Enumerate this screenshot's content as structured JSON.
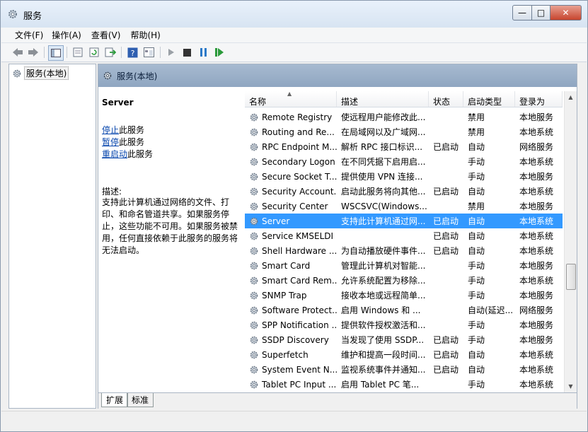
{
  "window": {
    "title": "服务",
    "min_glyph": "—",
    "max_glyph": "□",
    "close_glyph": "✕"
  },
  "menu": [
    "文件(F)",
    "操作(A)",
    "查看(V)",
    "帮助(H)"
  ],
  "tree": {
    "root_label": "服务(本地)"
  },
  "header": {
    "title": "服务(本地)"
  },
  "description": {
    "service_name": "Server",
    "actions": [
      {
        "link": "停止",
        "suffix": "此服务"
      },
      {
        "link": "暂停",
        "suffix": "此服务"
      },
      {
        "link": "重启动",
        "suffix": "此服务"
      }
    ],
    "label": "描述:",
    "text": "支持此计算机通过网络的文件、打印、和命名管道共享。如果服务停止，这些功能不可用。如果服务被禁用，任何直接依赖于此服务的服务将无法启动。"
  },
  "columns": [
    "名称",
    "描述",
    "状态",
    "启动类型",
    "登录为"
  ],
  "services": [
    {
      "name": "Remote Registry",
      "desc": "使远程用户能修改此...",
      "status": "",
      "startup": "禁用",
      "logon": "本地服务"
    },
    {
      "name": "Routing and Re...",
      "desc": "在局域网以及广域网...",
      "status": "",
      "startup": "禁用",
      "logon": "本地系统"
    },
    {
      "name": "RPC Endpoint M...",
      "desc": "解析 RPC 接口标识...",
      "status": "已启动",
      "startup": "自动",
      "logon": "网络服务"
    },
    {
      "name": "Secondary Logon",
      "desc": "在不同凭据下启用启...",
      "status": "",
      "startup": "手动",
      "logon": "本地系统"
    },
    {
      "name": "Secure Socket T...",
      "desc": "提供使用 VPN 连接...",
      "status": "",
      "startup": "手动",
      "logon": "本地服务"
    },
    {
      "name": "Security Account...",
      "desc": "启动此服务将向其他...",
      "status": "已启动",
      "startup": "自动",
      "logon": "本地系统"
    },
    {
      "name": "Security Center",
      "desc": "WSCSVC(Windows...",
      "status": "",
      "startup": "禁用",
      "logon": "本地服务"
    },
    {
      "name": "Server",
      "desc": "支持此计算机通过网...",
      "status": "已启动",
      "startup": "自动",
      "logon": "本地系统"
    },
    {
      "name": "Service KMSELDI",
      "desc": "",
      "status": "已启动",
      "startup": "自动",
      "logon": "本地系统"
    },
    {
      "name": "Shell Hardware ...",
      "desc": "为自动播放硬件事件...",
      "status": "已启动",
      "startup": "自动",
      "logon": "本地系统"
    },
    {
      "name": "Smart Card",
      "desc": "管理此计算机对智能...",
      "status": "",
      "startup": "手动",
      "logon": "本地服务"
    },
    {
      "name": "Smart Card Rem...",
      "desc": "允许系统配置为移除...",
      "status": "",
      "startup": "手动",
      "logon": "本地系统"
    },
    {
      "name": "SNMP Trap",
      "desc": "接收本地或远程简单...",
      "status": "",
      "startup": "手动",
      "logon": "本地服务"
    },
    {
      "name": "Software Protect...",
      "desc": "启用 Windows 和 ...",
      "status": "",
      "startup": "自动(延迟...",
      "logon": "网络服务"
    },
    {
      "name": "SPP Notification ...",
      "desc": "提供软件授权激活和...",
      "status": "",
      "startup": "手动",
      "logon": "本地服务"
    },
    {
      "name": "SSDP Discovery",
      "desc": "当发现了使用 SSDP...",
      "status": "已启动",
      "startup": "手动",
      "logon": "本地服务"
    },
    {
      "name": "Superfetch",
      "desc": "维护和提高一段时间...",
      "status": "已启动",
      "startup": "自动",
      "logon": "本地系统"
    },
    {
      "name": "System Event N...",
      "desc": "监视系统事件并通知...",
      "status": "已启动",
      "startup": "自动",
      "logon": "本地系统"
    },
    {
      "name": "Tablet PC Input ...",
      "desc": "启用 Tablet PC 笔...",
      "status": "",
      "startup": "手动",
      "logon": "本地系统"
    }
  ],
  "selected_service": "Server",
  "tabs": [
    "扩展",
    "标准"
  ],
  "icons": {
    "back": "back-arrow-icon",
    "forward": "forward-arrow-icon",
    "console_tree": "console-tree-icon",
    "properties": "properties-icon",
    "refresh": "refresh-icon",
    "export": "export-list-icon",
    "help": "help-icon",
    "view": "view-icon",
    "start": "play-icon",
    "stop": "stop-icon",
    "pause": "pause-icon",
    "restart": "restart-icon",
    "service": "gear-icon"
  },
  "colors": {
    "selection": "#3399ff",
    "header_band": "#9ab0c8",
    "link": "#0645ad"
  }
}
